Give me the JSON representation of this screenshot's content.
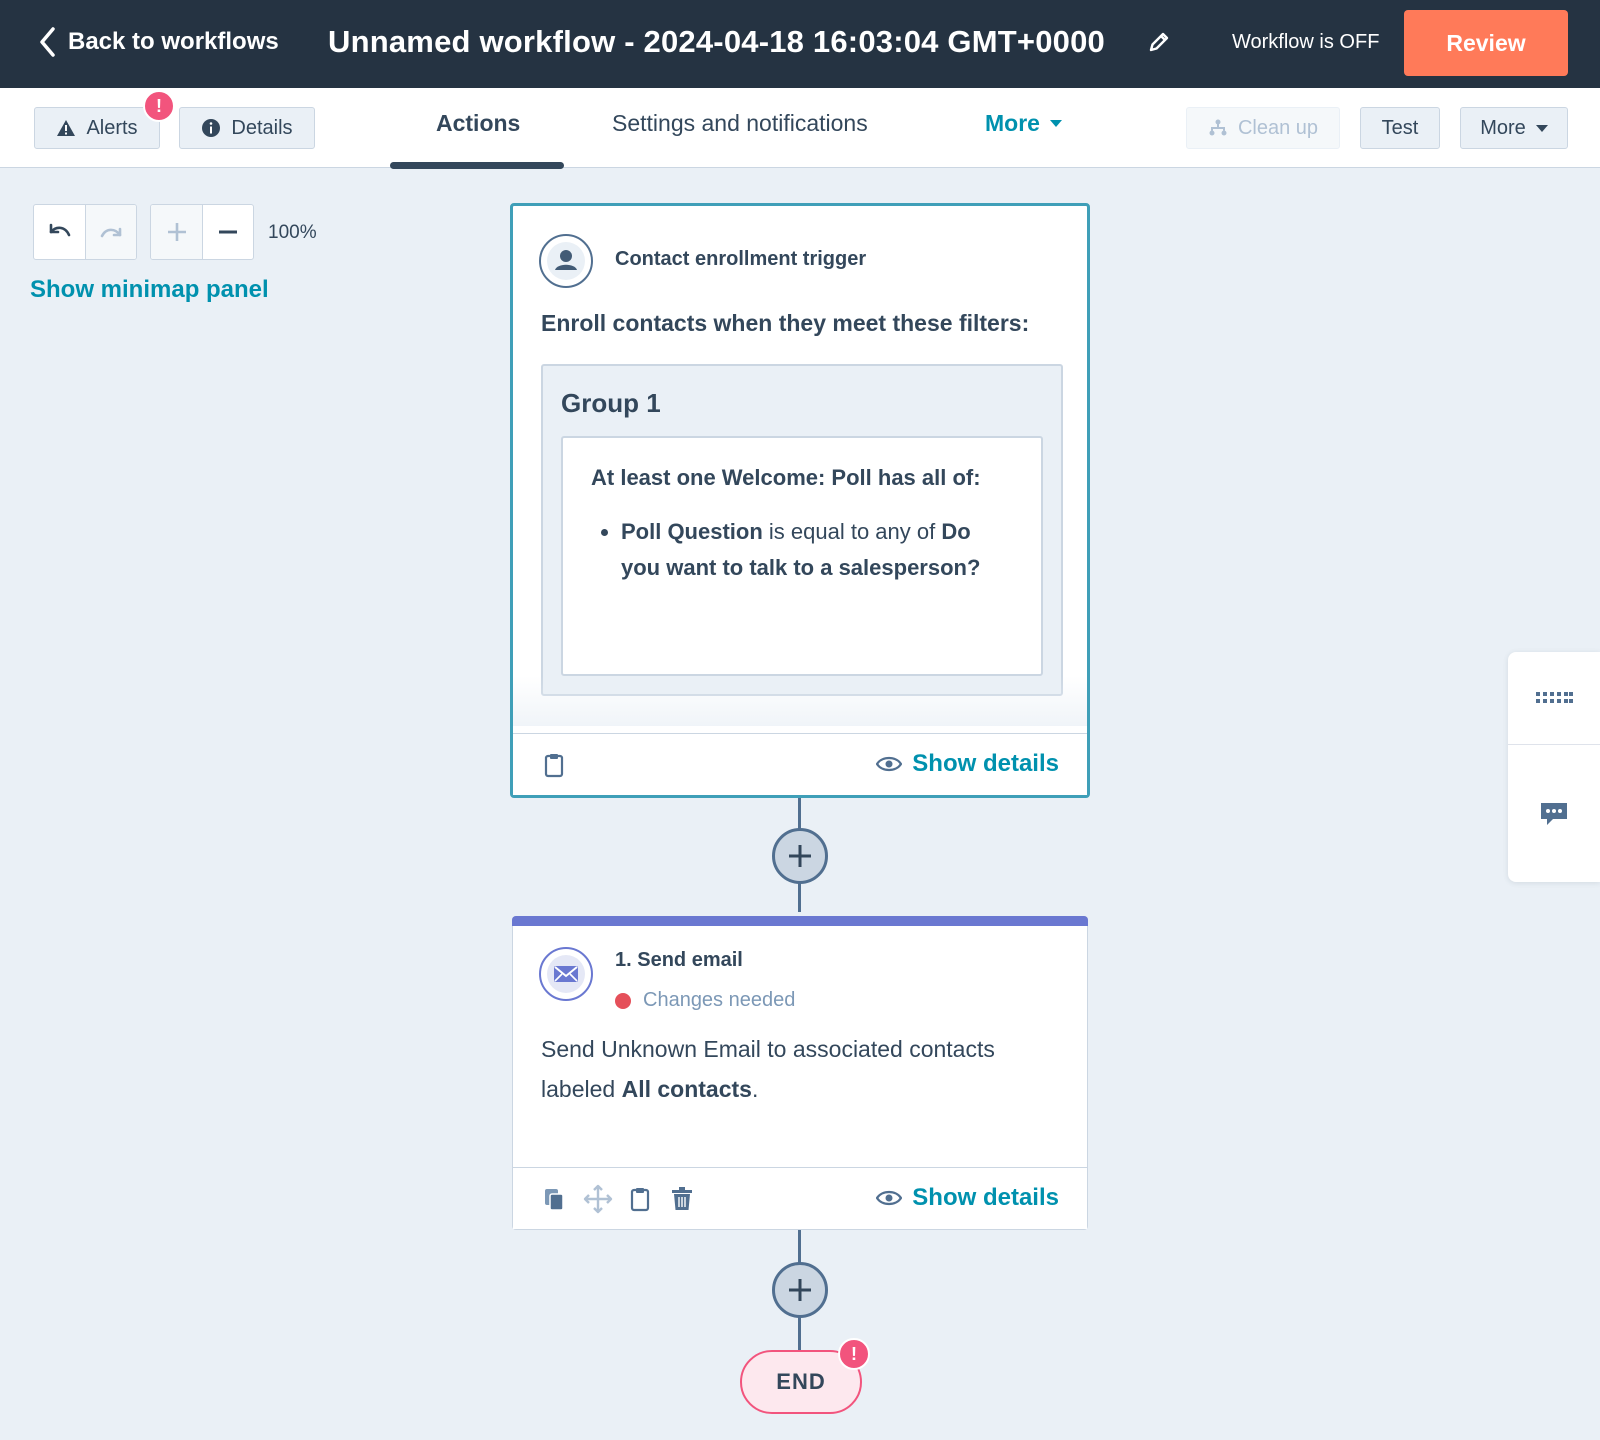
{
  "topbar": {
    "back_label": "Back to workflows",
    "workflow_title": "Unnamed workflow - 2024-04-18 16:03:04 GMT+0000",
    "status_text": "Workflow is OFF",
    "review_label": "Review"
  },
  "subbar": {
    "alerts_label": "Alerts",
    "alerts_badge": "!",
    "details_label": "Details",
    "tabs": [
      "Actions",
      "Settings and notifications",
      "More"
    ],
    "active_tab": "Actions",
    "cleanup_label": "Clean up",
    "test_label": "Test",
    "more_label": "More"
  },
  "canvas_controls": {
    "zoom_level": "100%",
    "minimap_label": "Show minimap panel"
  },
  "trigger_card": {
    "title": "Contact enrollment trigger",
    "enroll_text": "Enroll contacts when they meet these filters:",
    "group_title": "Group 1",
    "filter_heading": "At least one Welcome: Poll has all of:",
    "filter_property": "Poll Question",
    "filter_operator": " is equal to any of ",
    "filter_value": "Do you want to talk to a salesperson?",
    "show_details_label": "Show details"
  },
  "action_card": {
    "title": "1. Send email",
    "status_text": "Changes needed",
    "description_prefix": "Send Unknown Email to associated contacts labeled ",
    "description_bold": "All contacts",
    "description_suffix": ".",
    "show_details_label": "Show details"
  },
  "end_node": {
    "label": "END",
    "badge": "!"
  },
  "colors": {
    "topbar_bg": "#253342",
    "review_orange": "#ff7a59",
    "link_teal": "#0091ae",
    "trigger_border": "#3f9fb8",
    "action_purple": "#6a78d1",
    "alert_pink": "#f2547d",
    "status_red": "#e5505a",
    "canvas_bg": "#eaf0f6"
  },
  "icons": [
    "chevron-left-icon",
    "pencil-icon",
    "warning-icon",
    "info-icon",
    "cleanup-icon",
    "undo-icon",
    "redo-icon",
    "zoom-in-icon",
    "zoom-out-icon",
    "contact-icon",
    "email-icon",
    "clipboard-icon",
    "copy-icon",
    "move-icon",
    "trash-icon",
    "eye-icon",
    "keyboard-icon",
    "chat-icon"
  ]
}
